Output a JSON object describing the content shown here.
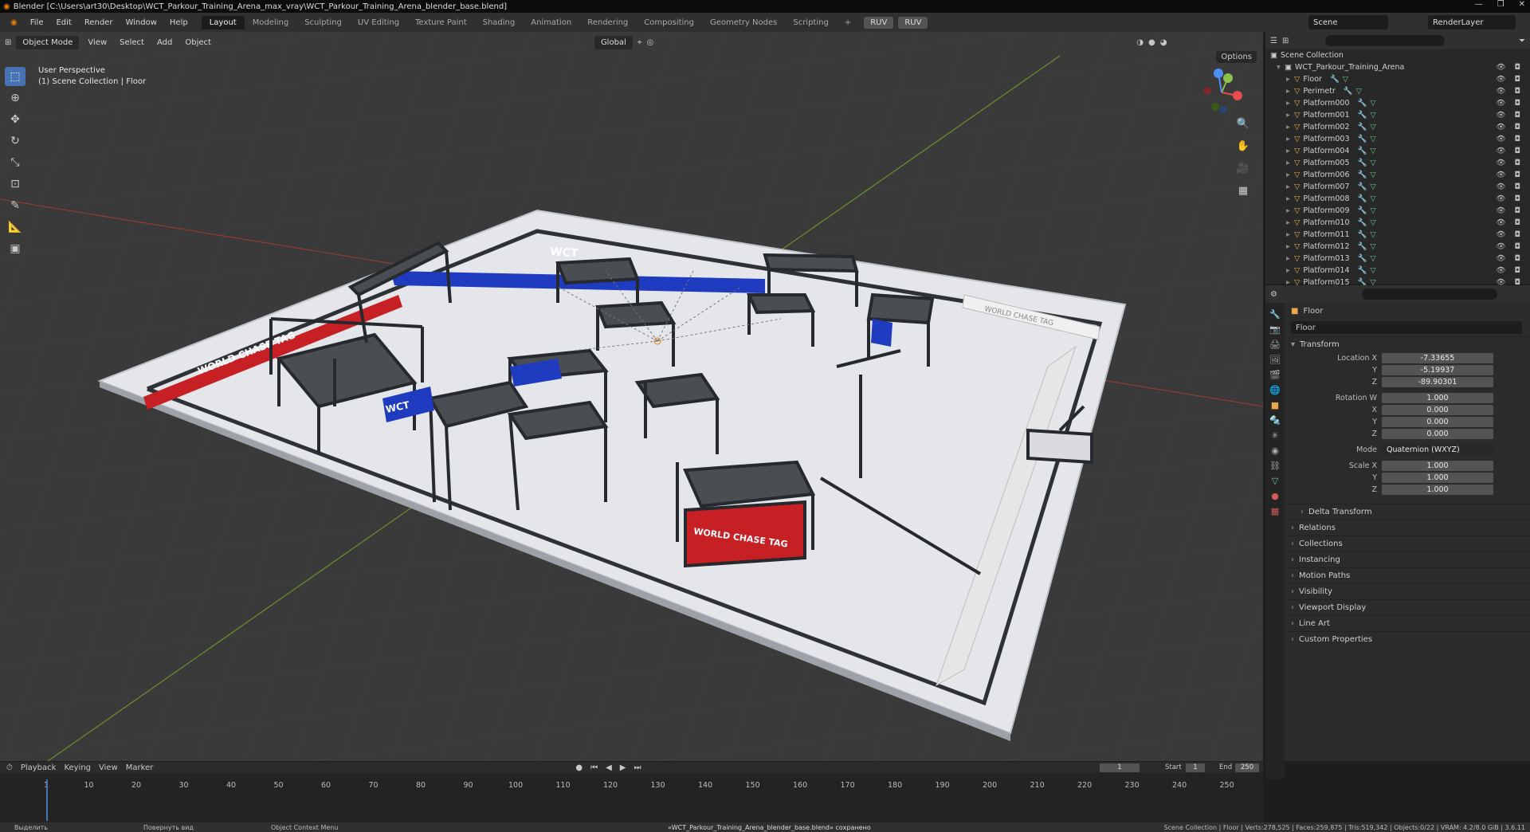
{
  "window": {
    "title": "Blender [C:\\Users\\art30\\Desktop\\WCT_Parkour_Training_Arena_max_vray\\WCT_Parkour_Training_Arena_blender_base.blend]"
  },
  "menu": [
    "File",
    "Edit",
    "Render",
    "Window",
    "Help"
  ],
  "workspaces": [
    "Layout",
    "Modeling",
    "Sculpting",
    "UV Editing",
    "Texture Paint",
    "Shading",
    "Animation",
    "Rendering",
    "Compositing",
    "Geometry Nodes",
    "Scripting"
  ],
  "ruv": [
    "RUV",
    "RUV"
  ],
  "scene": "Scene",
  "view_layer": "RenderLayer",
  "viewport": {
    "mode": "Object Mode",
    "menus": [
      "View",
      "Select",
      "Add",
      "Object"
    ],
    "orientation": "Global",
    "options": "Options",
    "perspective": "User Perspective",
    "collection_info": "(1) Scene Collection | Floor"
  },
  "scene_text": {
    "brand_long": "WORLD CHASE TAG",
    "brand_short": "WCT"
  },
  "outliner": {
    "root": "Scene Collection",
    "collection": "WCT_Parkour_Training_Arena",
    "items": [
      "Floor",
      "Perimetr",
      "Platform000",
      "Platform001",
      "Platform002",
      "Platform003",
      "Platform004",
      "Platform005",
      "Platform006",
      "Platform007",
      "Platform008",
      "Platform009",
      "Platform010",
      "Platform011",
      "Platform012",
      "Platform013",
      "Platform014",
      "Platform015"
    ]
  },
  "properties": {
    "object_name": "Floor",
    "data_name": "Floor",
    "transform_header": "Transform",
    "location": {
      "label": "Location X",
      "x": "-7.33655",
      "y": "-5.19937",
      "z": "-89.90301"
    },
    "rotation": {
      "label": "Rotation W",
      "w": "1.000",
      "x": "0.000",
      "y": "0.000",
      "z": "0.000"
    },
    "mode": {
      "label": "Mode",
      "value": "Quaternion (WXYZ)"
    },
    "scale": {
      "label": "Scale X",
      "x": "1.000",
      "y": "1.000",
      "z": "1.000"
    },
    "axes": [
      "X",
      "Y",
      "Z"
    ],
    "panels": [
      "Delta Transform",
      "Relations",
      "Collections",
      "Instancing",
      "Motion Paths",
      "Visibility",
      "Viewport Display",
      "Line Art",
      "Custom Properties"
    ]
  },
  "timeline": {
    "menus": [
      "Playback",
      "Keying",
      "View",
      "Marker"
    ],
    "current_frame": "1",
    "start_label": "Start",
    "start": "1",
    "end_label": "End",
    "end": "250",
    "ticks": [
      "1",
      "10",
      "20",
      "30",
      "40",
      "50",
      "60",
      "70",
      "80",
      "90",
      "100",
      "110",
      "120",
      "130",
      "140",
      "150",
      "160",
      "170",
      "180",
      "190",
      "200",
      "210",
      "220",
      "230",
      "240",
      "250"
    ]
  },
  "statusbar": {
    "select": "Выделить",
    "rotate": "Повернуть вид",
    "context": "Object Context Menu",
    "saved": "«WCT_Parkour_Training_Arena_blender_base.blend» сохранено",
    "stats": "Scene Collection | Floor | Verts:278,525 | Faces:259,875 | Tris:519,342 | Objects:0/22 | VRAM: 4.2/8.0 GiB | 3.6.11"
  }
}
